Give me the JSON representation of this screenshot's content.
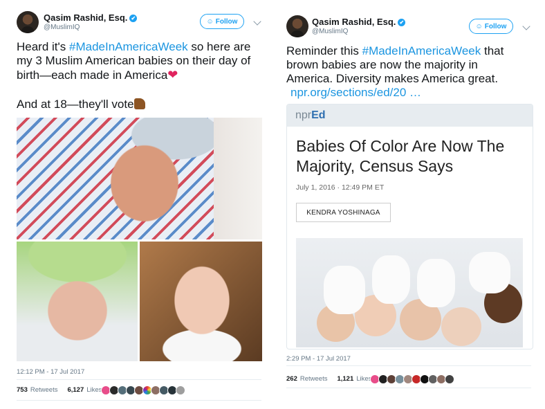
{
  "tweets": [
    {
      "author_name": "Qasim Rashid, Esq.",
      "verified_badge": "✔",
      "handle": "@MuslimIQ",
      "follow_label": "Follow",
      "text": {
        "line1_pre": "Heard it's ",
        "hashtag": "#MadeInAmericaWeek",
        "line1_post": " so here are",
        "line2": "my 3 Muslim American babies on their day of",
        "line3": "birth—each made in America",
        "line4": "And at 18—they'll vote"
      },
      "timestamp": "12:12 PM - 17 Jul 2017",
      "retweets_count": "753",
      "retweets_label": "Retweets",
      "likes_count": "6,127",
      "likes_label": "Likes"
    },
    {
      "author_name": "Qasim Rashid, Esq.",
      "verified_badge": "✔",
      "handle": "@MuslimIQ",
      "follow_label": "Follow",
      "text": {
        "line1_pre": "Reminder this ",
        "hashtag": "#MadeInAmericaWeek",
        "line1_post": " that",
        "line2": "brown babies are now the majority in",
        "line3": "America. Diversity makes America great.",
        "link": "npr.org/sections/ed/20  …"
      },
      "card": {
        "source_prefix": "npr",
        "source_suffix": "Ed",
        "headline": "Babies Of Color Are Now The Majority, Census Says",
        "date": "July 1, 2016 · 12:49 PM ET",
        "author": "KENDRA YOSHINAGA"
      },
      "timestamp": "2:29 PM - 17 Jul 2017",
      "retweets_count": "262",
      "retweets_label": "Retweets",
      "likes_count": "1,121",
      "likes_label": "Likes"
    }
  ],
  "icons": {
    "heart": "❤",
    "follow_person_plus": "👤+",
    "chevron": "chevron-down-icon"
  },
  "colors": {
    "link_blue": "#1b95e0",
    "follow_blue": "#1da1f2",
    "muted_gray": "#657786",
    "heart_red": "#e0245e"
  }
}
